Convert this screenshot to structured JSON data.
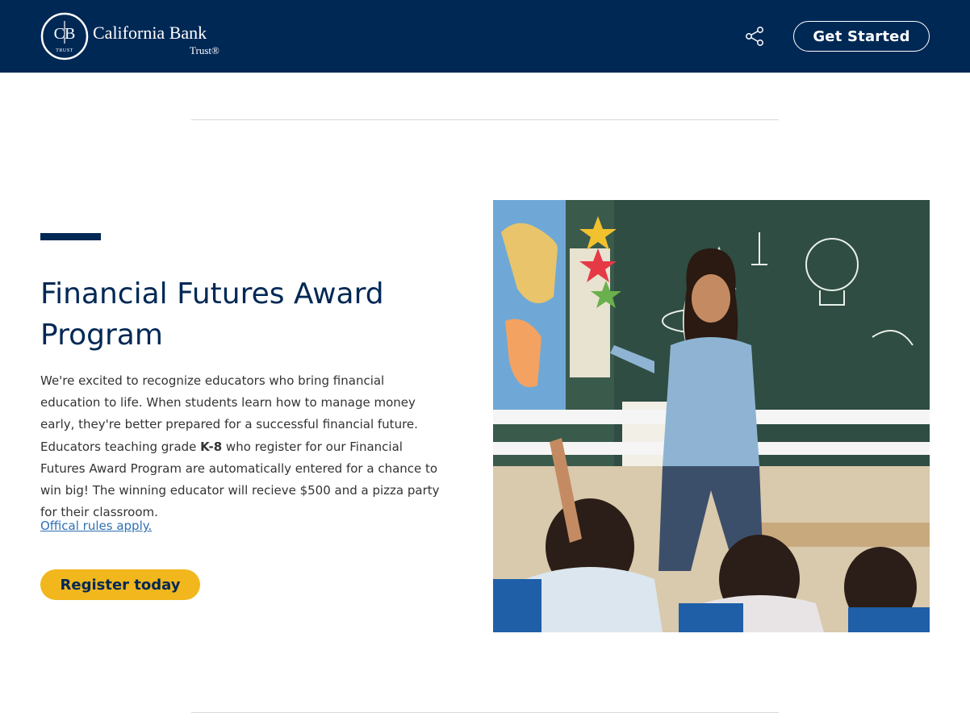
{
  "header": {
    "logo": {
      "monogram": "CB",
      "monogram_sub": "TRUST",
      "name_line1": "California Bank",
      "name_line2": "Trust®"
    },
    "share_icon": "share-icon",
    "get_started_label": "Get Started"
  },
  "section": {
    "title": "Financial Futures Award Program",
    "body_part1": "We're excited to recognize educators who bring financial education to life. When students learn how to manage money early, they're better prepared for a successful financial future. Educators teaching grade ",
    "body_bold": "K-8",
    "body_part2": " who register for our Financial Futures Award Program are automatically entered for a chance to win big! The winning educator will recieve $500 and a pizza party for their classroom.",
    "rules_link": "Offical rules apply. ",
    "register_label": "Register today",
    "image_alt": "Teacher smiling and pointing at students raising hands in a classroom"
  },
  "colors": {
    "brand_navy": "#002855",
    "accent_gold": "#f2b71c",
    "link_blue": "#2f6fb5",
    "divider": "#d9d9d9"
  }
}
